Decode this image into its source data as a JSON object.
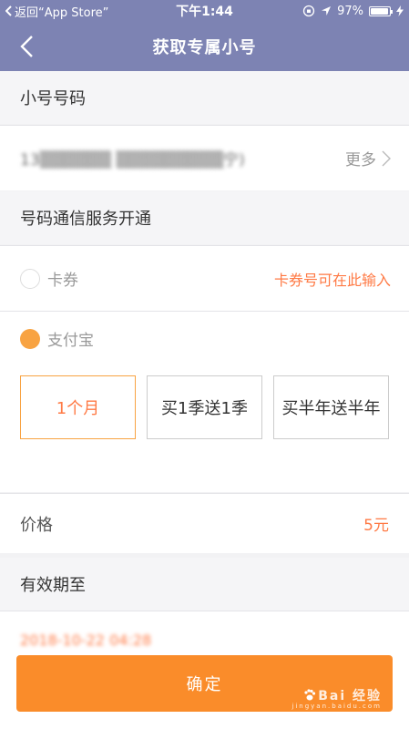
{
  "status_bar": {
    "back_text": "返回“App Store”",
    "time": "下午1:44",
    "battery": "97%",
    "battery_level": 0.97
  },
  "navbar": {
    "title": "获取专属小号"
  },
  "sections": {
    "number_title": "小号号码",
    "service_title": "号码通信服务开通",
    "expire_title": "有效期至"
  },
  "number_row": {
    "phone": "13▒▒▒▒▒▒ ▒▒▒▒▒▒▒▒▒宁)",
    "more_label": "更多"
  },
  "payment": {
    "coupon_label": "卡券",
    "coupon_link": "卡券号可在此输入",
    "alipay_label": "支付宝"
  },
  "plans": [
    {
      "label": "1个月",
      "selected": true
    },
    {
      "label": "买1季送1季",
      "selected": false
    },
    {
      "label": "买半年送半年",
      "selected": false
    }
  ],
  "price": {
    "label": "价格",
    "value": "5元"
  },
  "expire": {
    "value": "2018-10-22 04:28"
  },
  "confirm_label": "确定",
  "watermark": {
    "brand": "Bai 经验",
    "sub": "jingyan.baidu.com"
  },
  "colors": {
    "nav": "#7d83b3",
    "accent": "#ff7a45",
    "button": "#fa8c2a",
    "radio_checked": "#f8a342"
  }
}
